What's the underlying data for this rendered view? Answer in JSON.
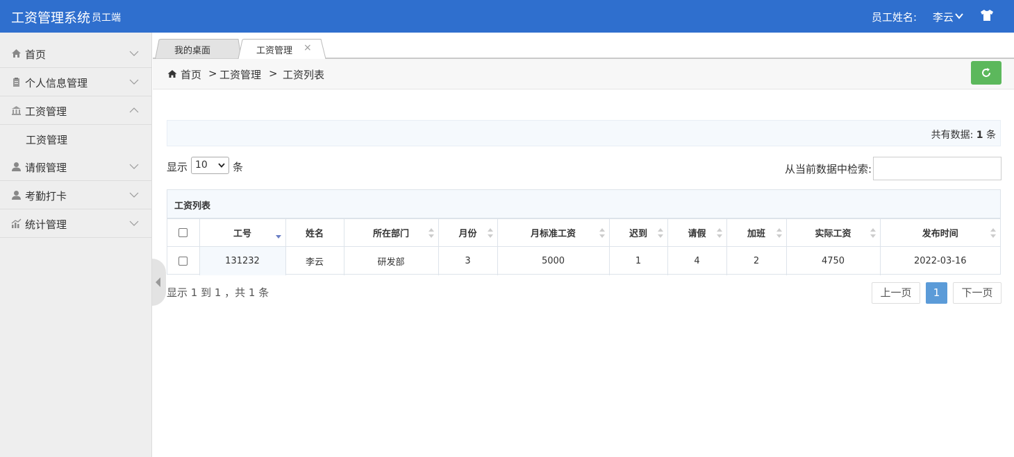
{
  "header": {
    "title": "工资管理系统",
    "subtitle": "员工端",
    "user_label": "员工姓名:",
    "user_name": "李云",
    "brand_color": "#2f6fce"
  },
  "sidebar": {
    "items": [
      {
        "label": "首页",
        "icon": "home-icon"
      },
      {
        "label": "个人信息管理",
        "icon": "clipboard-icon"
      },
      {
        "label": "工资管理",
        "icon": "bank-icon",
        "expanded": true
      },
      {
        "label": "工资管理",
        "submenu": true
      },
      {
        "label": "请假管理",
        "icon": "user-icon"
      },
      {
        "label": "考勤打卡",
        "icon": "user-icon"
      },
      {
        "label": "统计管理",
        "icon": "bar-chart-icon"
      }
    ]
  },
  "tabs": [
    {
      "label": "我的桌面",
      "active": false
    },
    {
      "label": "工资管理",
      "active": true,
      "close": "×"
    }
  ],
  "breadcrumb": {
    "items": [
      "首页",
      "工资管理",
      "工资列表"
    ],
    "separator": ">"
  },
  "summary": {
    "prefix": "共有数据:",
    "count": "1",
    "suffix": "条"
  },
  "length_control": {
    "prefix": "显示",
    "value": "10",
    "suffix": "条"
  },
  "search": {
    "label": "从当前数据中检索:",
    "value": ""
  },
  "table": {
    "caption": "工资列表",
    "columns": [
      "工号",
      "姓名",
      "所在部门",
      "月份",
      "月标准工资",
      "迟到",
      "请假",
      "加班",
      "实际工资",
      "发布时间"
    ],
    "rows": [
      [
        "131232",
        "李云",
        "研发部",
        "3",
        "5000",
        "1",
        "4",
        "2",
        "4750",
        "2022-03-16"
      ]
    ],
    "sorted_column": "工号"
  },
  "footer": {
    "info": "显示 1 到 1 ，共 1 条",
    "prev": "上一页",
    "current_page": "1",
    "next": "下一页",
    "accent_color": "#5b9bd8"
  },
  "refresh_button_color": "#5cb85c"
}
